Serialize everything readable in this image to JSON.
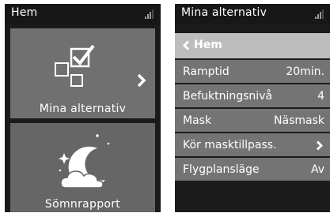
{
  "left_screen": {
    "title": "Hem",
    "tiles": [
      {
        "label": "Mina alternativ",
        "icon": "options-icon",
        "has_arrow": true
      },
      {
        "label": "Sömnrapport",
        "icon": "moon-cloud-icon"
      }
    ]
  },
  "right_screen": {
    "title": "Mina alternativ",
    "back_label": "Hem",
    "rows": [
      {
        "label": "Ramptid",
        "value": "20min."
      },
      {
        "label": "Befuktningsnivå",
        "value": "4"
      },
      {
        "label": "Mask",
        "value": "Näsmask"
      },
      {
        "label": "Kör masktillpass.",
        "value": ""
      },
      {
        "label": "Flygplansläge",
        "value": "Av"
      }
    ]
  },
  "colors": {
    "screen_bg": "#1b1b1b",
    "tile_bg": "#707070",
    "row_bg": "#747474",
    "back_bg": "#bdbdbd",
    "text": "#ffffff"
  }
}
